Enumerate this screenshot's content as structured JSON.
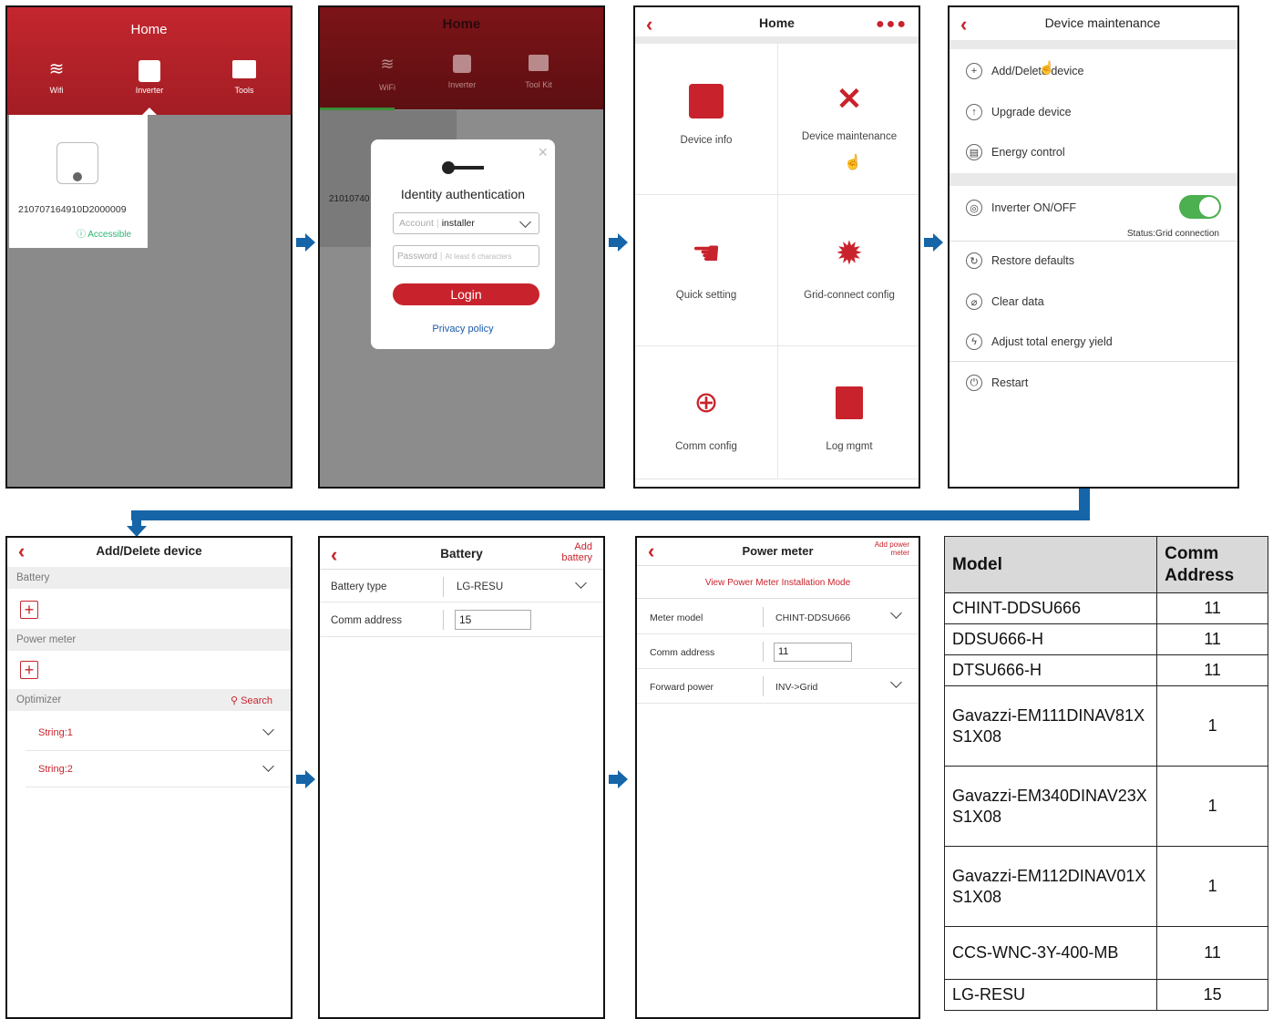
{
  "screen1": {
    "title": "Home",
    "tabs": [
      {
        "label": "Wifi"
      },
      {
        "label": "Inverter"
      },
      {
        "label": "Tools"
      }
    ],
    "device_serial": "210707164910D2000009",
    "status": "Accessible"
  },
  "screen2": {
    "title": "Home",
    "tabs": [
      {
        "label": "WiFi"
      },
      {
        "label": "Inverter"
      },
      {
        "label": "Tool Kit"
      }
    ],
    "partial_serial": "21010740",
    "dialog": {
      "title": "Identity authentication",
      "account_label": "Account",
      "account_value": "installer",
      "password_label": "Password",
      "password_placeholder": "At least 6 characters",
      "login_button": "Login",
      "privacy_link": "Privacy policy",
      "close": "×"
    }
  },
  "screen3": {
    "title": "Home",
    "tiles": [
      {
        "label": "Device info"
      },
      {
        "label": "Device maintenance"
      },
      {
        "label": "Quick setting"
      },
      {
        "label": "Grid-connect config"
      },
      {
        "label": "Comm config"
      },
      {
        "label": "Log mgmt"
      }
    ]
  },
  "screen4": {
    "title": "Device maintenance",
    "items": [
      {
        "label": "Add/Delete device"
      },
      {
        "label": "Upgrade device"
      },
      {
        "label": "Energy control"
      },
      {
        "label": "Inverter ON/OFF"
      },
      {
        "label": "Restore defaults"
      },
      {
        "label": "Clear data"
      },
      {
        "label": "Adjust total energy yield"
      },
      {
        "label": "Restart"
      }
    ],
    "status": "Status:Grid connection"
  },
  "screen5": {
    "title": "Add/Delete device",
    "sections": [
      {
        "label": "Battery"
      },
      {
        "label": "Power meter"
      },
      {
        "label": "Optimizer"
      }
    ],
    "search": "Search",
    "strings": [
      {
        "label": "String:1"
      },
      {
        "label": "String:2"
      }
    ]
  },
  "screen6": {
    "title": "Battery",
    "action": "Add battery",
    "rows": [
      {
        "label": "Battery type",
        "value": "LG-RESU"
      },
      {
        "label": "Comm address",
        "value": "15"
      }
    ]
  },
  "screen7": {
    "title": "Power meter",
    "action": "Add power meter",
    "link": "View Power Meter Installation Mode",
    "rows": [
      {
        "label": "Meter model",
        "value": "CHINT-DDSU666"
      },
      {
        "label": "Comm address",
        "value": "11"
      },
      {
        "label": "Forward power",
        "value": "INV->Grid"
      }
    ]
  },
  "table": {
    "headers": [
      "Model",
      "Comm Address"
    ],
    "rows": [
      [
        "CHINT-DDSU666",
        "11"
      ],
      [
        "DDSU666-H",
        "11"
      ],
      [
        "DTSU666-H",
        "11"
      ],
      [
        "Gavazzi-EM111DINAV81XS1X08",
        "1"
      ],
      [
        "Gavazzi-EM340DINAV23XS1X08",
        "1"
      ],
      [
        "Gavazzi-EM112DINAV01XS1X08",
        "1"
      ],
      [
        "CCS-WNC-3Y-400-MB",
        "11"
      ],
      [
        "LG-RESU",
        "15"
      ]
    ]
  },
  "colors": {
    "accent": "#c8232c",
    "flow": "#1565a8",
    "green": "#4caf50"
  }
}
